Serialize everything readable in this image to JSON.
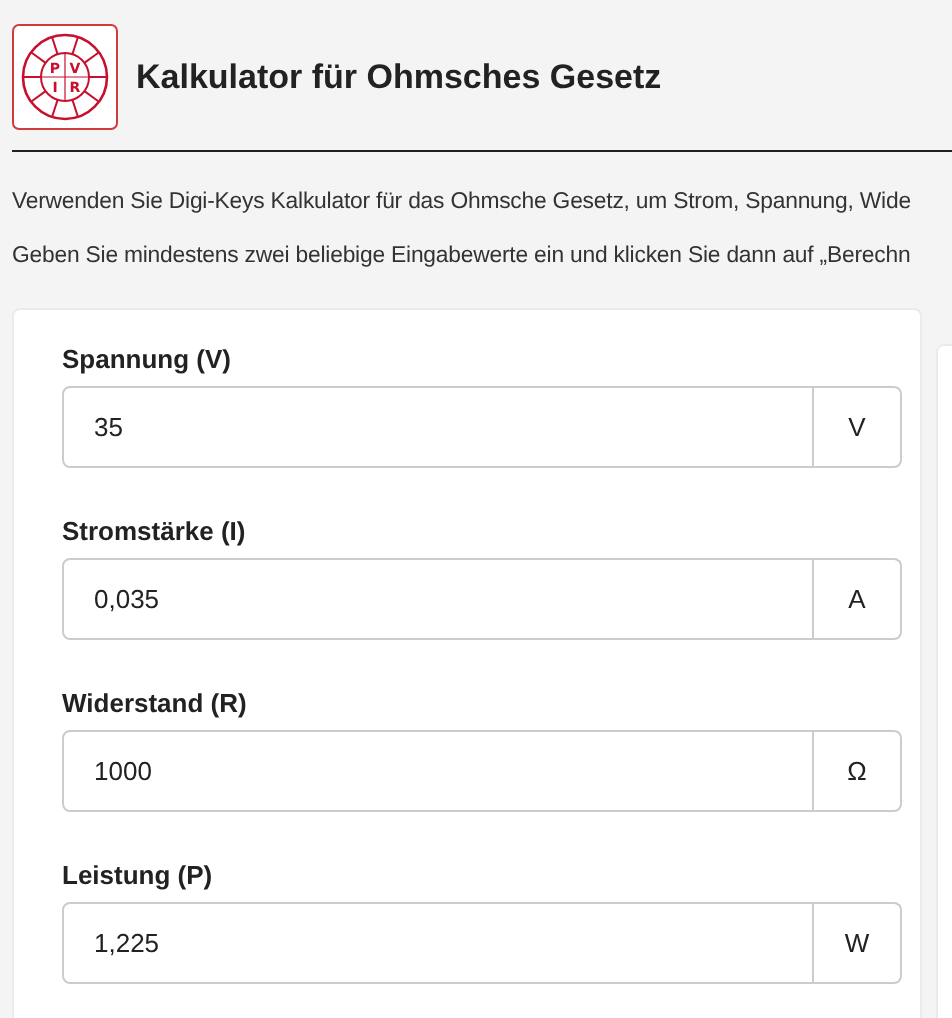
{
  "header": {
    "logo_letters": [
      "P",
      "V",
      "I",
      "R"
    ],
    "title": "Kalkulator für Ohmsches Gesetz"
  },
  "intro": [
    "Verwenden Sie Digi-Keys Kalkulator für das Ohmsche Gesetz, um Strom, Spannung, Wide",
    "Geben Sie mindestens zwei beliebige Eingabewerte ein und klicken Sie dann auf „Berechn"
  ],
  "fields": [
    {
      "label": "Spannung (V)",
      "value": "35",
      "unit": "V"
    },
    {
      "label": "Stromstärke (I)",
      "value": "0,035",
      "unit": "A"
    },
    {
      "label": "Widerstand (R)",
      "value": "1000",
      "unit": "Ω"
    },
    {
      "label": "Leistung (P)",
      "value": "1,225",
      "unit": "W"
    }
  ]
}
